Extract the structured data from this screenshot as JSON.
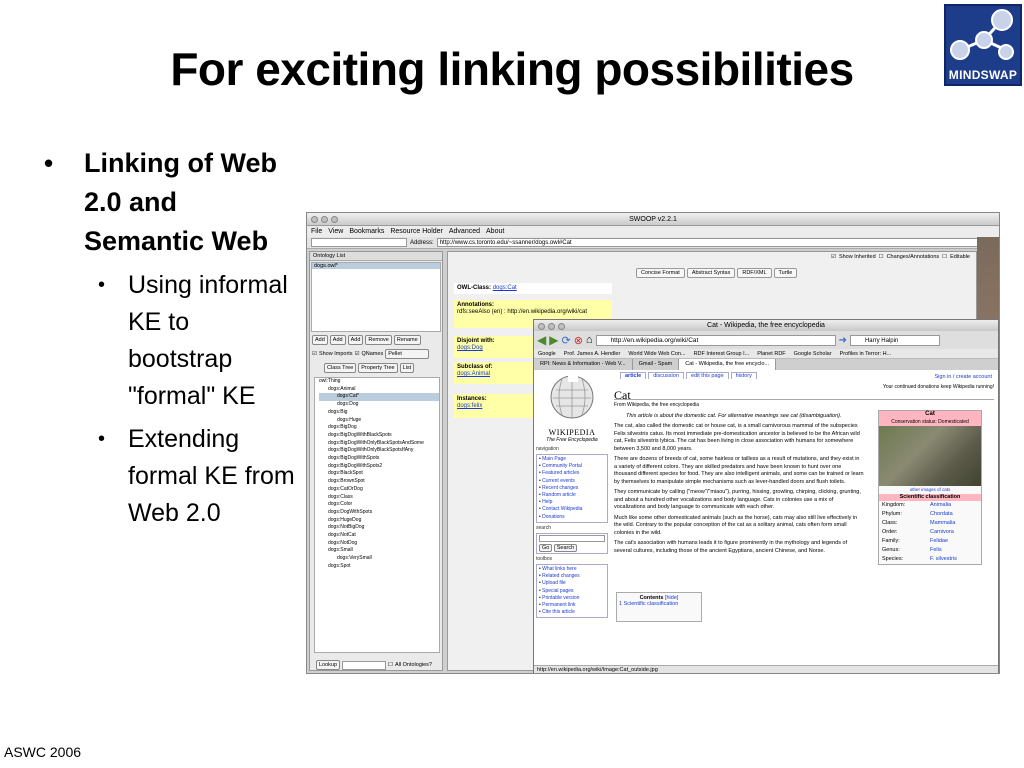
{
  "slide": {
    "title": "For exciting linking possibilities",
    "logo_text": "MINDSWAP",
    "footer": "ASWC 2006",
    "bullets": [
      {
        "text": "Linking of Web 2.0 and Semantic Web"
      },
      {
        "text": "Using informal KE to bootstrap \"formal\" KE"
      },
      {
        "text": "Extending formal KE from Web 2.0"
      }
    ]
  },
  "swoop": {
    "window_title": "SWOOP v2.2.1",
    "menu": [
      "File",
      "View",
      "Bookmarks",
      "Resource Holder",
      "Advanced",
      "About"
    ],
    "address_label": "Address:",
    "address": "http://www.cs.toronto.edu/~ssanner/dogs.owl#Cat",
    "ontology_list_label": "Ontology List",
    "ontology_selected": "dogs.owl*",
    "buttons": [
      "Add",
      "Add",
      "Add",
      "Remove",
      "Rename"
    ],
    "show_imports": "Show Imports",
    "qnames": "QNames",
    "reasoner": "Pellet",
    "tree_tabs": [
      "Class Tree",
      "Property Tree",
      "List"
    ],
    "tree": [
      "owl:Thing",
      "dogs:Animal",
      "dogs:Cat*",
      "dogs:Dog",
      "dogs:Big",
      "dogs:Huge",
      "dogs:BigDog",
      "dogs:BigDogWithBlackSpots",
      "dogs:BigDogWithOnlyBlackSpotsAndSome",
      "dogs:BigDogWithOnlyBlackSpotsIfAny",
      "dogs:BigDogWithSpots",
      "dogs:BigDogWithSpots2",
      "dogs:BlackSpot",
      "dogs:BrownSpot",
      "dogs:CatOrDog",
      "dogs:Class",
      "dogs:Color",
      "dogs:DogWithSpots",
      "dogs:HugeDog",
      "dogs:NotBigDog",
      "dogs:NotCat",
      "dogs:NotDog",
      "dogs:Small",
      "dogs:VerySmall",
      "dogs:Spot"
    ],
    "lookup": "Lookup",
    "all_ontologies": "All Ontologies?",
    "show_inherited": "Show Inherited",
    "changes": "Changes/Annotations",
    "editable": "Editable",
    "view_tabs": [
      "Concise Format",
      "Abstract Syntax",
      "RDF/XML",
      "Turtle"
    ],
    "owl_class_label": "OWL-Class:",
    "owl_class": "dogs:Cat",
    "annotations_label": "Annotations:",
    "annotation": "rdfs:seeAlso (en) : http://en.wikipedia.org/wiki/cat",
    "disjoint_label": "Disjoint with:",
    "disjoint": "dogs:Dog",
    "subclass_label": "Subclass of:",
    "subclass": "dogs:Animal",
    "instances_label": "Instances:",
    "instances": "dogs:felix"
  },
  "firefox": {
    "window_title": "Cat - Wikipedia, the free encyclopedia",
    "url": "http://en.wikipedia.org/wiki/Cat",
    "search": "Harry Halpin",
    "bookmarks": [
      "Google",
      "Prof. James A. Hendler",
      "World Wide Web Con...",
      "RDF Interest Group I...",
      "Planet RDF",
      "Google Scholar",
      "Profiles in Terror: H..."
    ],
    "tabs": [
      "RPI: News & Information - Web V...",
      "Gmail - Spam",
      "Cat - Wikipedia, the free encyclo..."
    ],
    "page_tabs": [
      "article",
      "discussion",
      "edit this page",
      "history"
    ],
    "signin": "Sign in / create account",
    "wiki_name": "WIKIPEDIA",
    "wiki_sub": "The Free Encyclopedia",
    "nav_label": "navigation",
    "nav": [
      "Main Page",
      "Community Portal",
      "Featured articles",
      "Current events",
      "Recent changes",
      "Random article",
      "Help",
      "Contact Wikipedia",
      "Donations"
    ],
    "search_label": "search",
    "go": "Go",
    "search_btn": "Search",
    "toolbox_label": "toolbox",
    "toolbox": [
      "What links here",
      "Related changes",
      "Upload file",
      "Special pages",
      "Printable version",
      "Permanent link",
      "Cite this article"
    ],
    "donation": "Your continued donations keep Wikipedia running!",
    "heading": "Cat",
    "from": "From Wikipedia, the free encyclopedia",
    "about": "This article is about the domestic cat. For alternative meanings see cat (disambiguation).",
    "p1": "The cat, also called the domestic cat or house cat, is a small carnivorous mammal of the subspecies Felis silvestris catus. Its most immediate pre-domestication ancestor is believed to be the African wild cat, Felis silvestris lybica. The cat has been living in close association with humans for somewhere between 3,500 and 8,000 years.",
    "p2": "There are dozens of breeds of cat, some hairless or tailless as a result of mutations, and they exist in a variety of different colors. They are skilled predators and have been known to hunt over one thousand different species for food. They are also intelligent animals, and some can be trained or learn by themselves to manipulate simple mechanisms such as lever-handled doors and flush toilets.",
    "p3": "They communicate by calling (\"meow\"/\"miaou\"), purring, hissing, growling, chirping, clicking, grunting, and about a hundred other vocalizations and body language. Cats in colonies use a mix of vocalizations and body language to communicate with each other.",
    "p4": "Much like some other domesticated animals (such as the horse), cats may also still live effectively in the wild. Contrary to the popular conception of the cat as a solitary animal, cats often form small colonies in the wild.",
    "p5": "The cat's association with humans leads it to figure prominently in the mythology and legends of several cultures, including those of the ancient Egyptians, ancient Chinese, and Norse.",
    "contents": "Contents",
    "hide": "[hide]",
    "contents_item": "1 Scientific classification",
    "infobox_title": "Cat",
    "status": "Conservation status: Domesticated",
    "other_images": "other images of cats",
    "sci": "Scientific classification",
    "taxonomy": [
      {
        "rank": "Kingdom:",
        "value": "Animalia"
      },
      {
        "rank": "Phylum:",
        "value": "Chordata"
      },
      {
        "rank": "Class:",
        "value": "Mammalia"
      },
      {
        "rank": "Order:",
        "value": "Carnivora"
      },
      {
        "rank": "Family:",
        "value": "Felidae"
      },
      {
        "rank": "Genus:",
        "value": "Felis"
      },
      {
        "rank": "Species:",
        "value": "F. silvestris"
      }
    ],
    "statusbar": "http://en.wikipedia.org/wiki/Image:Cat_outside.jpg"
  }
}
